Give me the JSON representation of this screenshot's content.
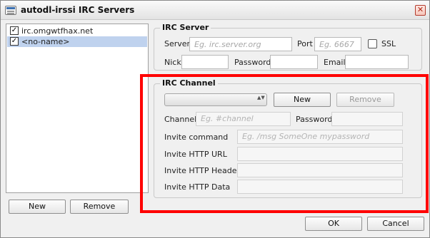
{
  "window": {
    "title": "autodl-irssi IRC Servers",
    "close_glyph": "✕"
  },
  "server_list": {
    "items": [
      {
        "label": "irc.omgwtfhax.net",
        "checked": true,
        "selected": false
      },
      {
        "label": "<no-name>",
        "checked": true,
        "selected": true
      }
    ],
    "check_glyph": "✓",
    "new_label": "New",
    "remove_label": "Remove"
  },
  "irc_server": {
    "title": "IRC Server",
    "server_label": "Server",
    "server_placeholder": "Eg. irc.server.org",
    "port_label": "Port",
    "port_placeholder": "Eg. 6667",
    "ssl_label": "SSL",
    "nick_label": "Nick",
    "password_label": "Password",
    "email_label": "Email"
  },
  "irc_channel": {
    "title": "IRC Channel",
    "combo_value": "",
    "combo_arrows": "▲▼",
    "new_label": "New",
    "remove_label": "Remove",
    "channel_label": "Channel",
    "channel_placeholder": "Eg. #channel",
    "password_label": "Password",
    "invite_command_label": "Invite command",
    "invite_command_placeholder": "Eg. /msg SomeOne mypassword",
    "invite_http_url_label": "Invite HTTP URL",
    "invite_http_header_label": "Invite HTTP Header",
    "invite_http_data_label": "Invite HTTP Data"
  },
  "footer": {
    "ok_label": "OK",
    "cancel_label": "Cancel"
  },
  "colors": {
    "highlight": "#ff0000",
    "selection": "#bfd2ee"
  }
}
